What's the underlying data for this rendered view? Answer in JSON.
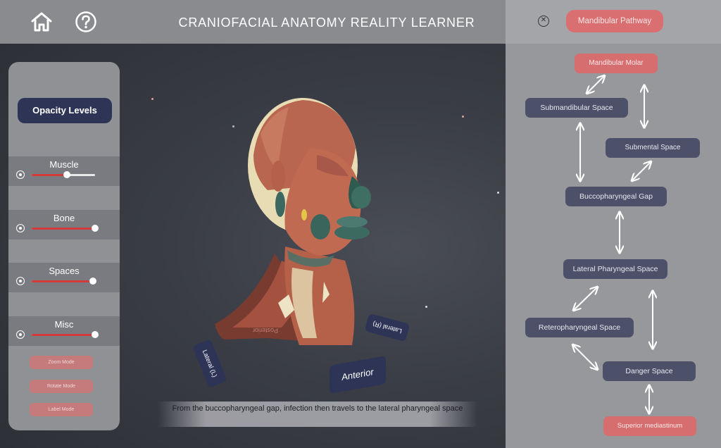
{
  "header": {
    "title": "CRANIOFACIAL ANATOMY REALITY LEARNER",
    "home_icon": "home-icon",
    "help_icon": "help-icon"
  },
  "left_panel": {
    "title": "Opacity Levels",
    "sliders": [
      {
        "label": "Muscle",
        "value": 0.56
      },
      {
        "label": "Bone",
        "value": 1.0
      },
      {
        "label": "Spaces",
        "value": 0.97
      },
      {
        "label": "Misc",
        "value": 1.0
      }
    ],
    "modes": [
      "Zoom Mode",
      "Rotate Mode",
      "Label Mode"
    ]
  },
  "scene": {
    "caption": "From the buccopharyngeal gap, infection then travels to the lateral pharyngeal space",
    "labels": {
      "anterior": "Anterior",
      "lateral_l": "Lateral (L)",
      "lateral_r": "Lateral (R)",
      "posterior": "Posterior"
    }
  },
  "right_panel": {
    "close_icon": "close-icon",
    "pathway_button": "Mandibular Pathway",
    "nodes": {
      "mandibular_molar": "Mandibular Molar",
      "submandibular_space": "Submandibular Space",
      "submental_space": "Submental Space",
      "buccopharyngeal_gap": "Buccopharyngeal Gap",
      "lateral_pharyngeal_space": "Lateral Pharyngeal Space",
      "retropharyngeal_space": "Reteropharyngeal Space",
      "danger_space": "Danger Space",
      "superior_mediastinum": "Superior mediastinum"
    }
  },
  "colors": {
    "header_bg": "#8a8b8f",
    "panel_bg": "#909195",
    "accent_navy": "#2e3456",
    "accent_red": "#d66e70",
    "slider_red": "#d33a3a"
  }
}
